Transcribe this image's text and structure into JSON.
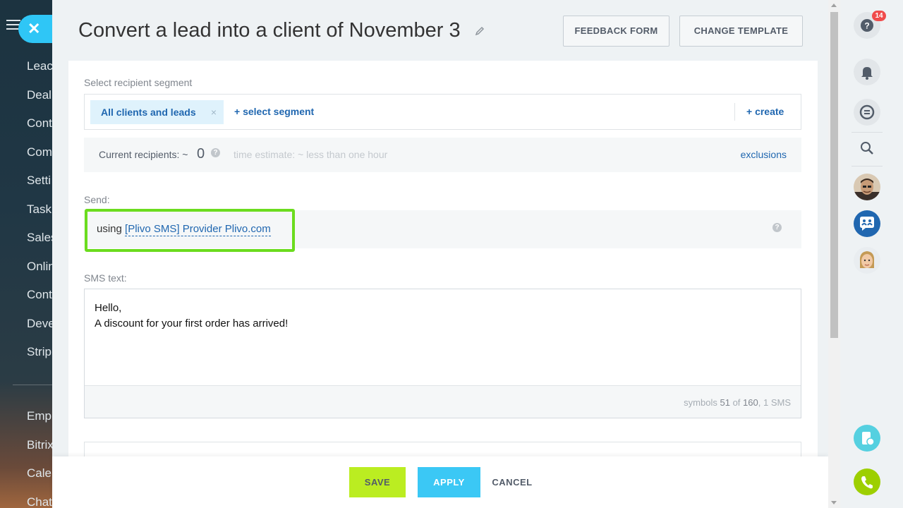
{
  "sidebar": {
    "items": [
      "Leac",
      "Deal",
      "Cont",
      "Com",
      "Setti",
      "Task",
      "Sales",
      "Onlin",
      "Cont",
      "Deve",
      "Strip"
    ],
    "items2": [
      "Emp",
      "Bitrix",
      "Cale",
      "Chat"
    ]
  },
  "header": {
    "title": "Convert a lead into a client of November 3",
    "feedback_label": "FEEDBACK FORM",
    "template_label": "CHANGE TEMPLATE"
  },
  "segment": {
    "label": "Select recipient segment",
    "chip": "All clients and leads",
    "chip_close": "×",
    "select_link": "+ select segment",
    "create_link": "+ create"
  },
  "recipients": {
    "label": "Current recipients: ~",
    "count": "0",
    "help": "?",
    "estimate": "time estimate: ~ less than one hour",
    "exclusions": "exclusions"
  },
  "send": {
    "label": "Send:",
    "using": "using",
    "provider": "[Plivo SMS] Provider Plivo.com",
    "help": "?"
  },
  "sms": {
    "label": "SMS text:",
    "line1": "Hello,",
    "line2": "A discount for your first order has arrived!",
    "counter_prefix": "symbols",
    "counter_used": "51",
    "counter_of": "of",
    "counter_max": "160",
    "counter_sms": ", 1 SMS"
  },
  "footer": {
    "save": "SAVE",
    "apply": "APPLY",
    "cancel": "CANCEL"
  },
  "right_panel": {
    "help": "?",
    "badge": "14"
  },
  "colors": {
    "accent_blue": "#2067b0",
    "save_green": "#bbed21",
    "apply_blue": "#3bc8f5",
    "highlight_green": "#6bdc1e",
    "badge_red": "#f04b4b"
  }
}
